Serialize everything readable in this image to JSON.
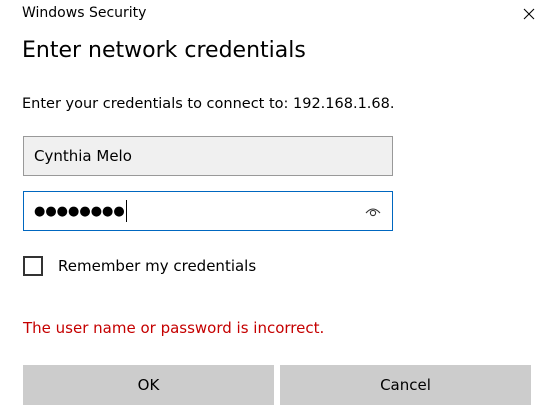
{
  "window": {
    "title": "Windows Security",
    "close_icon": "close-icon"
  },
  "dialog": {
    "heading": "Enter network credentials",
    "message": "Enter your credentials to connect to: 192.168.1.68.",
    "username": {
      "value": "Cynthia Melo"
    },
    "password": {
      "masked_value": "●●●●●●●●",
      "reveal_icon": "eye-icon"
    },
    "remember": {
      "label": "Remember my credentials",
      "checked": false
    },
    "error": "The user name or password is incorrect.",
    "buttons": {
      "ok": "OK",
      "cancel": "Cancel"
    }
  },
  "colors": {
    "accent": "#0067c0",
    "error": "#c50000",
    "button_bg": "#cccccc",
    "field_bg": "#f0f0f0"
  }
}
